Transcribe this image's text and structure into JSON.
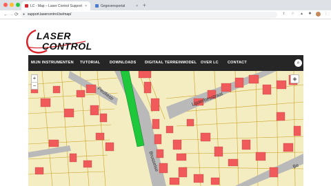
{
  "browser": {
    "tabs": [
      {
        "label": "LC - Map – Laser Control Support",
        "active": true
      },
      {
        "label": "Gegevensportal",
        "active": false
      }
    ],
    "new_tab": "+",
    "url": "support.lasercontrol.be/map/",
    "back": "←",
    "forward": "→",
    "reload": "⟳",
    "close_glyph": "×"
  },
  "logo": {
    "line1": "LASER",
    "line2": "CONTROL"
  },
  "menu": {
    "items": [
      "MIJN INSTRUMENTEN",
      "TUTORIAL",
      "DOWNLOADS",
      "DIGITAAL TERREINMODEL",
      "OVER LC",
      "CONTACT"
    ],
    "search_icon": "search-icon"
  },
  "map": {
    "zoom_in": "+",
    "zoom_out": "−",
    "layers_icon": "layers-icon",
    "streets": [
      "Peutiestr",
      "Lijsterbesstraat",
      "Brusselse",
      "Be"
    ]
  },
  "colors": {
    "menubar": "#262626",
    "parcel": "#f5edc2",
    "building": "#f05a5a",
    "parcel_line": "#c9a227",
    "highlight": "#1ec83a",
    "road": "#b9b9b9",
    "brand_red": "#d7262c"
  }
}
